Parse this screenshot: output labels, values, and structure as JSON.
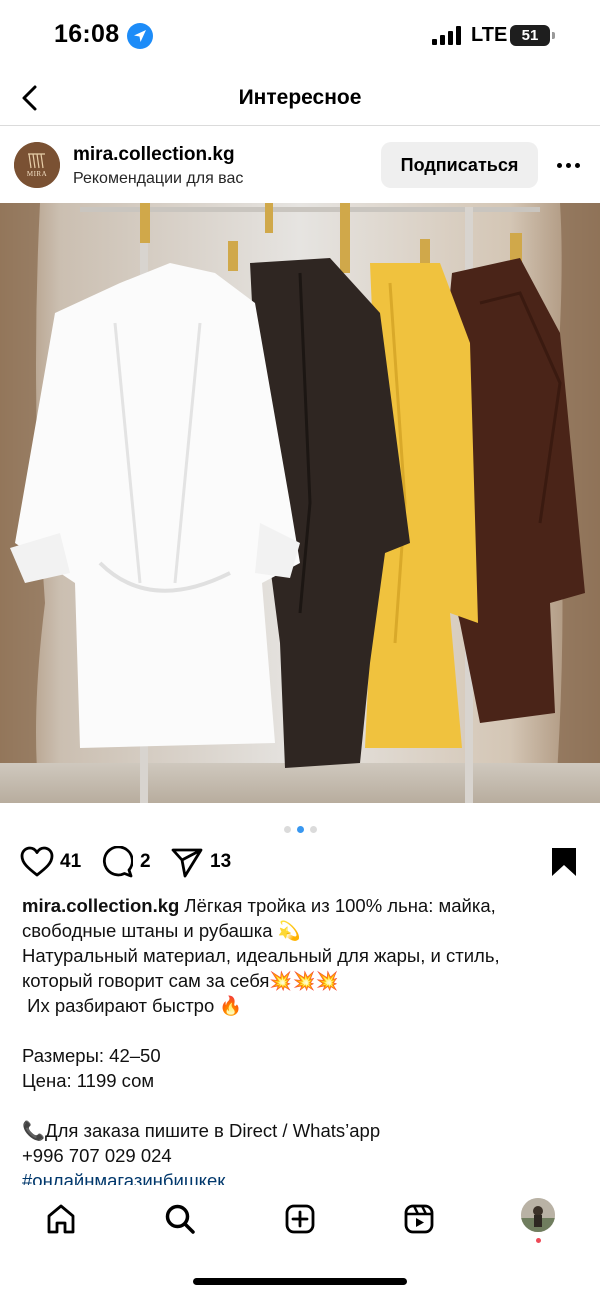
{
  "status_bar": {
    "time": "16:08",
    "network": "LTE",
    "battery_level": "51",
    "location_icon": "location-arrow-icon",
    "signal_icon": "cellular-signal-icon"
  },
  "nav": {
    "title": "Интересное",
    "back_icon": "chevron-left-icon"
  },
  "post": {
    "username": "mira.collection.kg",
    "subtitle": "Рекомендации для вас",
    "avatar_text": "MIRA",
    "follow_label": "Подписаться",
    "more_icon": "more-dots-icon",
    "carousel": {
      "count": 3,
      "active_index": 1
    },
    "likes": "41",
    "comments": "2",
    "shares": "13",
    "caption": {
      "username": "mira.collection.kg",
      "line1": " Лёгкая тройка из 100% льна: майка,",
      "line2": "свободные штаны и рубашка 💫",
      "line3": "Натуральный материал, идеальный для жары, и стиль,",
      "line4": "который говорит сам за себя💥💥💥",
      "line5": " Их разбирают быстро 🔥",
      "line6": "Размеры: 42–50",
      "line7": "Цена: 1199 сом",
      "line8": "📞Для заказа пишите в Direct / Whats’app",
      "line9": "+996 707 029 024",
      "line10": "#онлайнмагазинбишкек"
    }
  },
  "tabbar": {
    "icons": [
      "home-icon",
      "search-icon",
      "new-post-icon",
      "reels-icon",
      "profile-avatar"
    ]
  },
  "colors": {
    "accent_blue": "#3897f0",
    "follow_bg": "#efefef",
    "hashtag": "#00376b",
    "notification": "#ed4956"
  }
}
